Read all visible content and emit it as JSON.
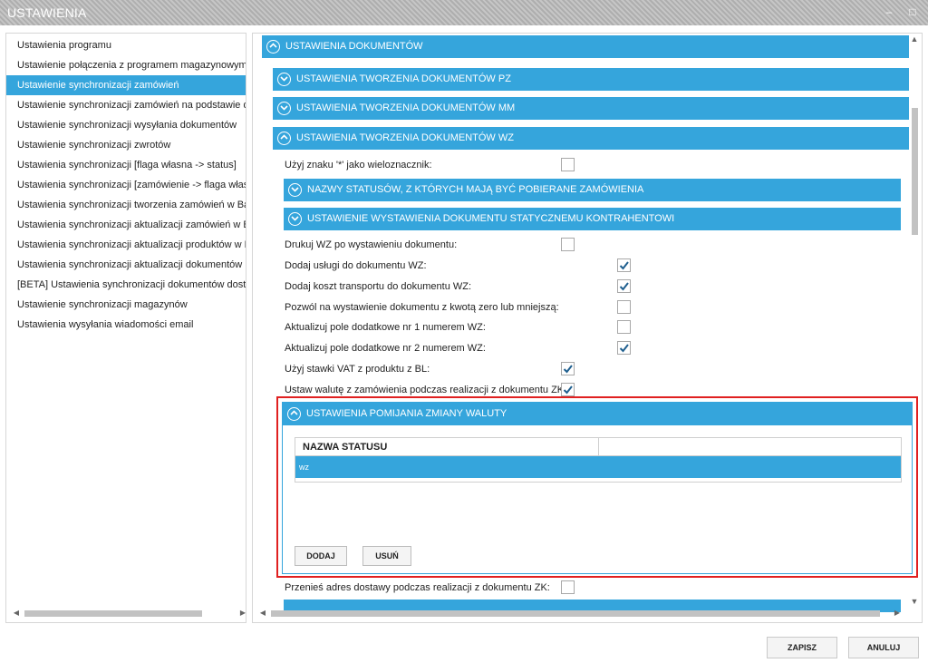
{
  "window": {
    "title": "USTAWIENIA",
    "minimize": "–",
    "maximize": "□"
  },
  "sidebar": {
    "items": [
      {
        "label": "Ustawienia programu"
      },
      {
        "label": "Ustawienie połączenia z programem magazynowym"
      },
      {
        "label": "Ustawienie synchronizacji zamówień",
        "selected": true
      },
      {
        "label": "Ustawienie synchronizacji zamówień na podstawie dzi"
      },
      {
        "label": "Ustawienie synchronizacji wysyłania dokumentów"
      },
      {
        "label": "Ustawienie synchronizacji zwrotów"
      },
      {
        "label": "Ustawienia synchronizacji [flaga własna -> status]"
      },
      {
        "label": "Ustawienia synchronizacji [zamówienie -> flaga własn"
      },
      {
        "label": "Ustawienia synchronizacji tworzenia zamówień w Base"
      },
      {
        "label": "Ustawienia synchronizacji aktualizacji zamówień w Bas"
      },
      {
        "label": "Ustawienia synchronizacji aktualizacji produktów w Ba"
      },
      {
        "label": "Ustawienia synchronizacji aktualizacji dokumentów"
      },
      {
        "label": "[BETA] Ustawienia synchronizacji dokumentów dostaw"
      },
      {
        "label": "Ustawienie synchronizacji magazynów"
      },
      {
        "label": "Ustawienia wysyłania wiadomości email"
      }
    ]
  },
  "main": {
    "sections": {
      "dokumenty": "USTAWIENIA DOKUMENTÓW",
      "pz": "USTAWIENIA TWORZENIA DOKUMENTÓW PZ",
      "mm": "USTAWIENIA TWORZENIA DOKUMENTÓW MM",
      "wz": "USTAWIENIA TWORZENIA DOKUMENTÓW WZ",
      "statusy": "NAZWY STATUSÓW, Z KTÓRYCH MAJĄ BYĆ POBIERANE ZAMÓWIENIA",
      "kontrahent": "USTAWIENIE WYSTAWIENIA DOKUMENTU STATYCZNEMU KONTRAHENTOWI",
      "waluta": "USTAWIENIA POMIJANIA ZMIANY WALUTY"
    },
    "wildcard": {
      "label": "Użyj znaku '*' jako wieloznacznik:",
      "checked": false
    },
    "options": [
      {
        "label": "Drukuj WZ po wystawieniu dokumentu:",
        "checked": false
      },
      {
        "label": "Dodaj usługi do dokumentu WZ:",
        "checked": true
      },
      {
        "label": "Dodaj koszt transportu do dokumentu WZ:",
        "checked": true
      },
      {
        "label": "Pozwól na wystawienie dokumentu z kwotą zero lub mniejszą:",
        "checked": false
      },
      {
        "label": "Aktualizuj pole dodatkowe nr 1 numerem WZ:",
        "checked": false
      },
      {
        "label": "Aktualizuj pole dodatkowe nr 2 numerem WZ:",
        "checked": true
      },
      {
        "label": "Użyj stawki VAT z produktu z BL:",
        "checked": true
      },
      {
        "label": "Ustaw walutę z zamówienia podczas realizacji z dokumentu ZK:",
        "checked": true
      }
    ],
    "currency_table": {
      "column_header": "NAZWA STATUSU",
      "rows": [
        "wz"
      ]
    },
    "buttons": {
      "add": "DODAJ",
      "remove": "USUŃ"
    },
    "transfer_address": {
      "label": "Przenieś adres dostawy podczas realizacji z dokumentu ZK:",
      "checked": false
    }
  },
  "footer": {
    "save": "ZAPISZ",
    "cancel": "ANULUJ"
  },
  "colors": {
    "accent": "#35a5dc",
    "highlight": "#e02020"
  }
}
